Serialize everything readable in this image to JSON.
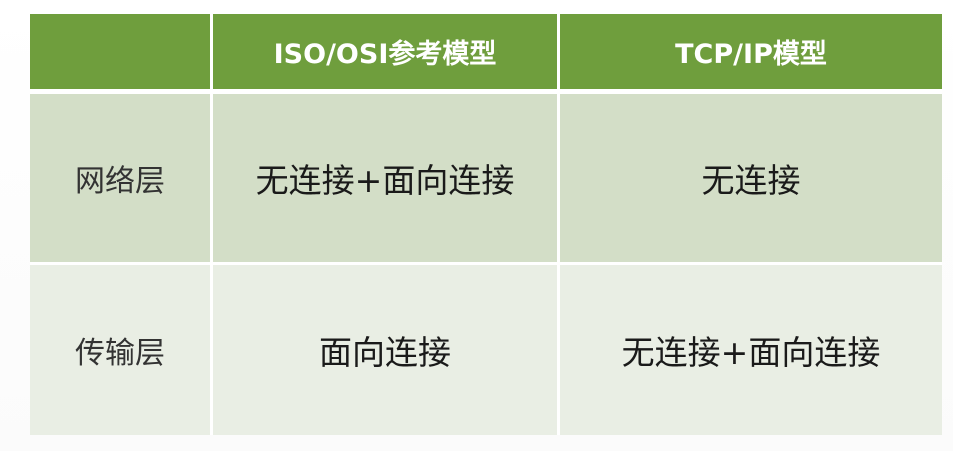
{
  "table": {
    "header": {
      "corner": "",
      "osi": "ISO/OSI参考模型",
      "tcpip": "TCP/IP模型"
    },
    "rows": [
      {
        "layer": "网络层",
        "osi": "无连接+面向连接",
        "tcpip": "无连接"
      },
      {
        "layer": "传输层",
        "osi": "面向连接",
        "tcpip": "无连接+面向连接"
      }
    ]
  },
  "colors": {
    "header_bg": "#6f9e3d",
    "header_text": "#ffffff",
    "row_dark_bg": "#d3dec7",
    "row_light_bg": "#e9eee4"
  }
}
